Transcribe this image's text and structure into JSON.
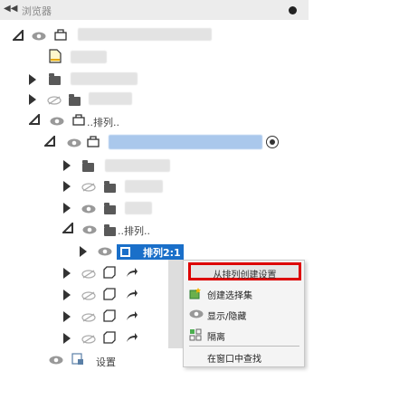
{
  "header": {
    "title": "浏览器",
    "collapse_icon": "double-chevron-left-icon",
    "pin_icon": "dot-icon"
  },
  "tree": {
    "pattern_label_1": "..排列..",
    "pattern_label_2": "..排列..",
    "selected_item": "排列2:1",
    "settings_label": "设置"
  },
  "context_menu": {
    "items": [
      {
        "label": "从排列创建设置",
        "icon": ""
      },
      {
        "label": "创建选择集",
        "icon": "selection-set-icon"
      },
      {
        "label": "显示/隐藏",
        "icon": "eye-icon"
      },
      {
        "label": "隔离",
        "icon": "isolate-icon"
      },
      {
        "label": "在窗口中查找",
        "icon": ""
      }
    ]
  },
  "colors": {
    "selection": "#1a6fc9",
    "highlight_border": "#dd0000"
  }
}
